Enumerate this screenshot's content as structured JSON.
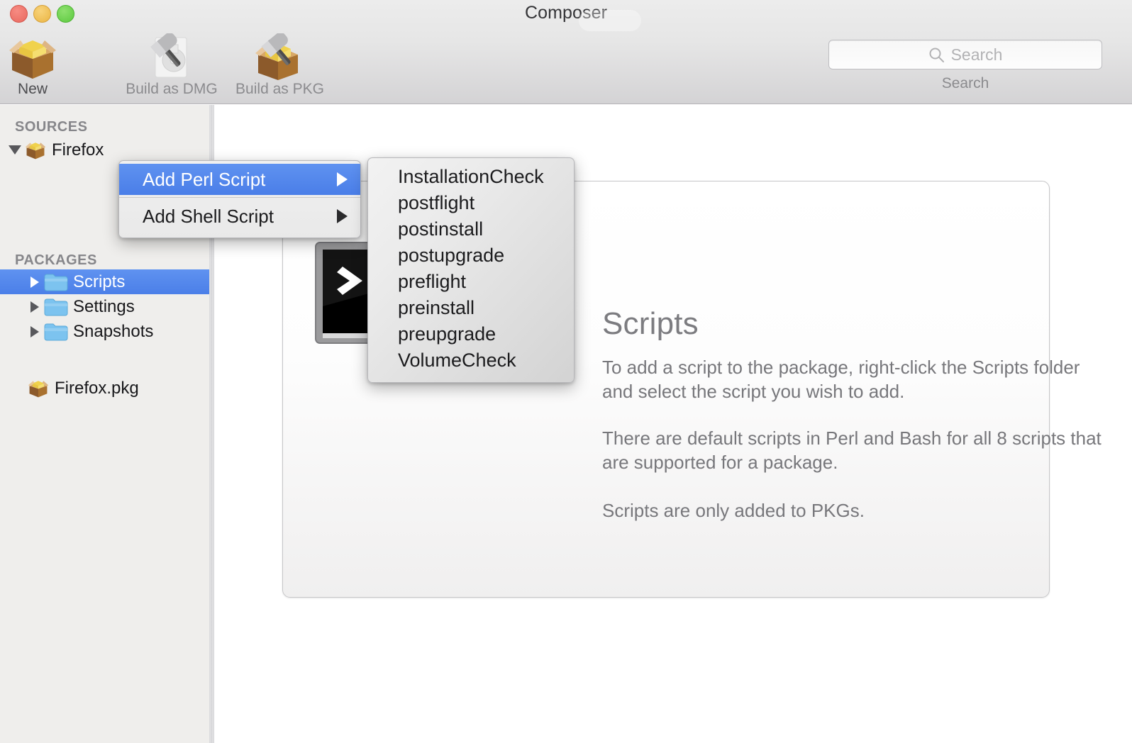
{
  "window": {
    "title": "Composer",
    "traffic_lights": [
      "close",
      "minimize",
      "maximize"
    ]
  },
  "toolbar": {
    "items": [
      {
        "id": "new",
        "label": "New",
        "icon": "package-box-icon"
      },
      {
        "id": "build_dmg",
        "label": "Build as DMG",
        "icon": "hammer-disk-icon"
      },
      {
        "id": "build_pkg",
        "label": "Build as PKG",
        "icon": "hammer-package-icon"
      }
    ],
    "search": {
      "placeholder": "Search",
      "value": "",
      "caption": "Search",
      "icon": "search-icon"
    }
  },
  "sidebar": {
    "groups": [
      {
        "id": "sources",
        "title": "SOURCES",
        "items": [
          {
            "id": "firefox",
            "label": "Firefox",
            "icon": "package-box-icon",
            "disclosure": "down",
            "selected": false,
            "indent": 0
          },
          {
            "id": "scripts",
            "label": "Scripts",
            "icon": "folder-icon",
            "disclosure": "right",
            "selected": true,
            "indent": 1
          },
          {
            "id": "settings",
            "label": "Settings",
            "icon": "folder-icon",
            "disclosure": "right",
            "selected": false,
            "indent": 1
          },
          {
            "id": "snapshots",
            "label": "Snapshots",
            "icon": "folder-icon",
            "disclosure": "right",
            "selected": false,
            "indent": 1
          }
        ]
      },
      {
        "id": "packages",
        "title": "PACKAGES",
        "items": [
          {
            "id": "firefox_pkg",
            "label": "Firefox.pkg",
            "icon": "package-box-icon",
            "disclosure": "none",
            "selected": false,
            "indent": 1
          }
        ]
      }
    ]
  },
  "main": {
    "panel": {
      "icon": "terminal-icon",
      "title": "Scripts",
      "paragraphs": [
        "To add a script to the package, right-click the Scripts folder and select the script you wish to add.",
        "There are default scripts in Perl and Bash for all 8 scripts that are supported for a package.",
        "Scripts are only added to PKGs."
      ]
    }
  },
  "context_menu": {
    "items": [
      {
        "id": "add_perl_script",
        "label": "Add Perl Script",
        "has_submenu": true,
        "highlighted": true
      },
      {
        "id": "add_shell_script",
        "label": "Add Shell Script",
        "has_submenu": true,
        "highlighted": false
      }
    ]
  },
  "submenu": {
    "items": [
      {
        "id": "installationcheck",
        "label": "InstallationCheck"
      },
      {
        "id": "postflight",
        "label": "postflight"
      },
      {
        "id": "postinstall",
        "label": "postinstall"
      },
      {
        "id": "postupgrade",
        "label": "postupgrade"
      },
      {
        "id": "preflight",
        "label": "preflight"
      },
      {
        "id": "preinstall",
        "label": "preinstall"
      },
      {
        "id": "preupgrade",
        "label": "preupgrade"
      },
      {
        "id": "volumecheck",
        "label": "VolumeCheck"
      }
    ]
  },
  "colors": {
    "selection_blue": "#4b7fe8",
    "toolbar_bg": "#e6e6e6",
    "sidebar_bg": "#efeeec",
    "text_primary": "#17171a",
    "text_secondary": "#77777b",
    "group_header": "#86868a"
  }
}
